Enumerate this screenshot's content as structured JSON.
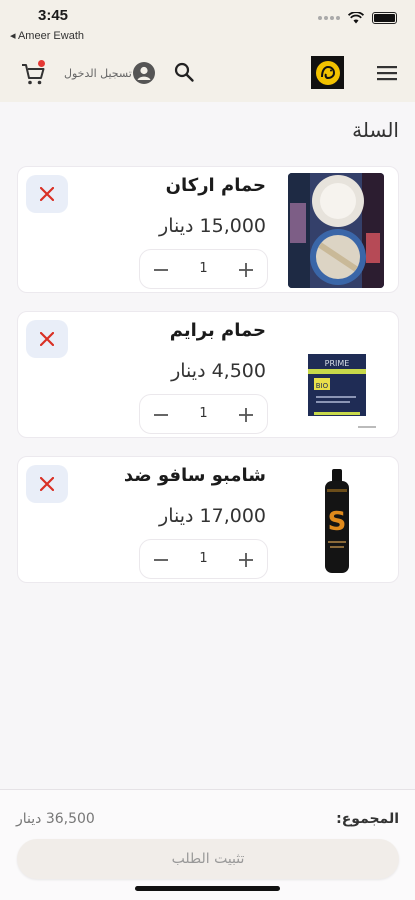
{
  "status_bar": {
    "time": "3:45",
    "back_label": "◂ Ameer Ewath"
  },
  "header": {
    "login_label": "تسجيل الدخول",
    "icons": [
      "cart-icon",
      "account-icon",
      "search-icon",
      "store-logo",
      "menu-icon"
    ]
  },
  "page": {
    "title": "السلة"
  },
  "cart": {
    "items": [
      {
        "name": "حمام اركان",
        "price": "15,000 دينار",
        "quantity": "1"
      },
      {
        "name": "حمام برايم",
        "price": "4,500 دينار",
        "quantity": "1"
      },
      {
        "name": "شامبو سافو ضد",
        "price": "17,000 دينار",
        "quantity": "1"
      }
    ]
  },
  "summary": {
    "total_label": "المجموع:",
    "total_value": "36,500 دينار",
    "checkout_label": "تثبيت الطلب"
  },
  "product_images": {
    "0": {
      "brand_text": ""
    },
    "1": {
      "brand_text": "PRIME"
    },
    "2": {
      "brand_text": "S"
    }
  },
  "colors": {
    "header_bg": "#f3f0e9",
    "remove_bg": "#e9eef8",
    "remove_icon": "#d93025",
    "badge": "#e53935"
  }
}
